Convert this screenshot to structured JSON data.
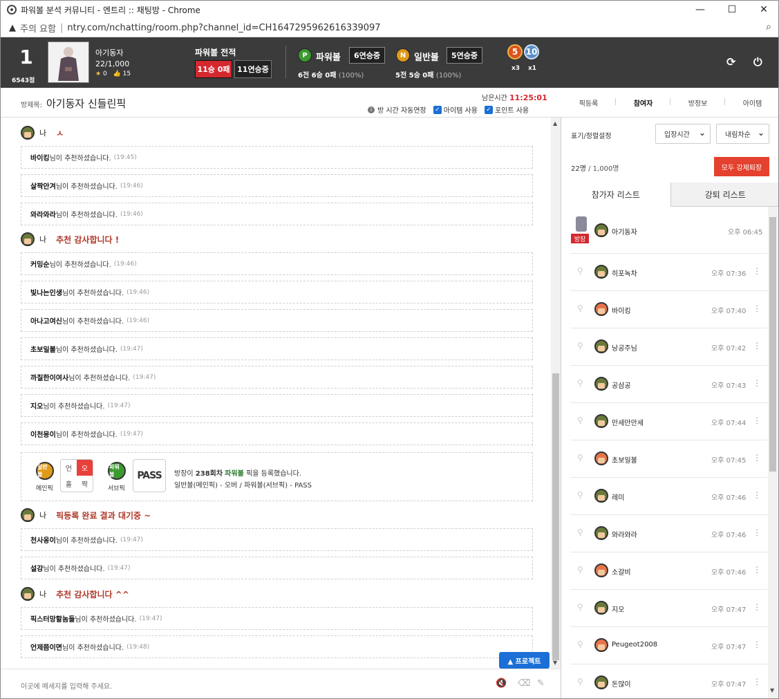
{
  "window": {
    "title": "파워볼 분석 커뮤니티 - 엔트리 :: 채팅방 - Chrome",
    "minimize": "—",
    "maximize": "☐",
    "close": "✕"
  },
  "urlbar": {
    "security": "주의 요함",
    "url": "ntry.com/nchatting/room.php?channel_id=CH1647295962616339097"
  },
  "header": {
    "rank": "1",
    "score": "6543점",
    "nickname": "아기동자",
    "members": "22/1,000",
    "stars": "0",
    "likes": "15",
    "record_title": "파워볼 전적",
    "record_win_loss": "11승 0패",
    "record_streak": "11연승중",
    "powerball": {
      "ball": "P",
      "title": "파워볼",
      "streak": "6연승중",
      "summary": "6전 6승 0패",
      "pct": "(100%)"
    },
    "normalball": {
      "ball": "N",
      "title": "일반볼",
      "streak": "5연승중",
      "summary": "5전 5승 0패",
      "pct": "(100%)"
    },
    "medals": [
      {
        "num": "5",
        "count": "x3"
      },
      {
        "num": "10",
        "count": "x1"
      }
    ],
    "refresh_icon": "⟳",
    "power_icon": "⏻"
  },
  "room": {
    "label": "방제목:",
    "name": "아기동자 신들린픽",
    "remain_label": "남은시간",
    "remain_time": "11:25:01",
    "auto_extend": "방 시간 자동연장",
    "use_item": "아이템 사용",
    "use_point": "포인트 사용"
  },
  "tabs": [
    "픽등록",
    "참여자",
    "방정보",
    "아이템"
  ],
  "chat": {
    "me": "나",
    "mine": [
      {
        "text": "ㅅ"
      },
      {
        "text": "추천 감사합니다 !"
      },
      {
        "text": "픽등록 완료 결과 대기중 ~"
      },
      {
        "text": "추천 감사합니다 ^^"
      }
    ],
    "suffix": "님이 추천하셨습니다.",
    "notices": [
      {
        "name": "바이킹",
        "time": "(19:45)"
      },
      {
        "name": "살짝안겨",
        "time": "(19:46)"
      },
      {
        "name": "와라와라",
        "time": "(19:46)"
      },
      {
        "name": "커밍순",
        "time": "(19:46)"
      },
      {
        "name": "빛나는인생",
        "time": "(19:46)"
      },
      {
        "name": "아나고여신",
        "time": "(19:46)"
      },
      {
        "name": "초보일볼",
        "time": "(19:47)"
      },
      {
        "name": "까칠한이여사",
        "time": "(19:47)"
      },
      {
        "name": "지오",
        "time": "(19:47)"
      },
      {
        "name": "이천몽이",
        "time": "(19:47)"
      },
      {
        "name": "천사옹이",
        "time": "(19:47)"
      },
      {
        "name": "설강",
        "time": "(19:47)"
      },
      {
        "name": "픽스터망할놈들",
        "time": "(19:47)"
      },
      {
        "name": "언제쯤이면",
        "time": "(19:48)"
      }
    ],
    "pick": {
      "main_ball": "일반볼",
      "main_label": "메인픽",
      "grid": [
        "언",
        "오",
        "홀",
        "짝"
      ],
      "sub_ball": "파워볼",
      "sub_label": "서브픽",
      "pass": "PASS",
      "line1_pre": "방장이 ",
      "line1_round": "238회차",
      "line1_game": "파워볼",
      "line1_post": " 픽을 등록했습니다.",
      "line2": "일반볼(메인픽) - 오버 / 파워볼(서브픽) - PASS"
    },
    "protect_button": "▲ 프로젝트",
    "input_placeholder": "이곳에 메세지를 입력해 주세요."
  },
  "sidebar": {
    "sort_label": "표기/정렬설정",
    "sort_by": "입장시간",
    "sort_order": "내림차순",
    "count": "22명",
    "capacity": "/ 1,000명",
    "kick_all": "모두 강제퇴장",
    "list_tabs": [
      "참가자 리스트",
      "강퇴 리스트"
    ],
    "owner_tag": "방장",
    "participants": [
      {
        "name": "아기동자",
        "time": "오후 06:45",
        "owner": true
      },
      {
        "name": "히포녹차",
        "time": "오후 07:36"
      },
      {
        "name": "바이킹",
        "time": "오후 07:40",
        "new": true
      },
      {
        "name": "낭공주님",
        "time": "오후 07:42"
      },
      {
        "name": "공삼공",
        "time": "오후 07:43"
      },
      {
        "name": "만세만만세",
        "time": "오후 07:44"
      },
      {
        "name": "초보일볼",
        "time": "오후 07:45",
        "new": true
      },
      {
        "name": "레미",
        "time": "오후 07:46"
      },
      {
        "name": "와라와라",
        "time": "오후 07:46"
      },
      {
        "name": "소갈비",
        "time": "오후 07:46",
        "new": true
      },
      {
        "name": "지오",
        "time": "오후 07:47"
      },
      {
        "name": "Peugeot2008",
        "time": "오후 07:47",
        "new": true
      },
      {
        "name": "돈많이",
        "time": "오후 07:47"
      }
    ]
  }
}
